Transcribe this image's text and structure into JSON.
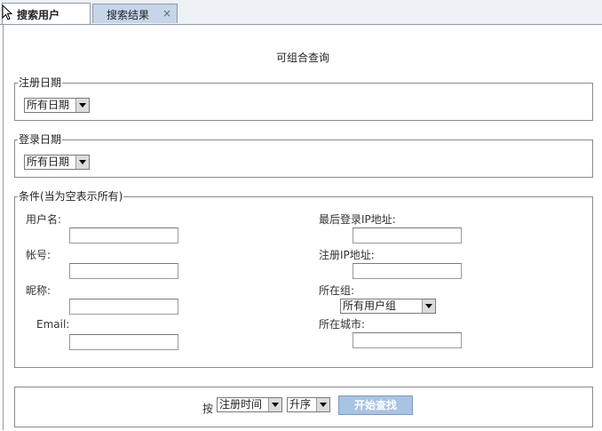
{
  "tabs": [
    {
      "label": "搜索用户",
      "active": true
    },
    {
      "label": "搜索结果",
      "active": false
    }
  ],
  "close_icon": "×",
  "page_title": "可组合查询",
  "register_date": {
    "legend": "注册日期",
    "selected": "所有日期"
  },
  "login_date": {
    "legend": "登录日期",
    "selected": "所有日期"
  },
  "conditions": {
    "legend": "条件(当为空表示所有)",
    "username_label": "用户名:",
    "account_label": "帐号:",
    "nickname_label": "昵称:",
    "email_label": "Email:",
    "last_login_ip_label": "最后登录IP地址:",
    "register_ip_label": "注册IP地址:",
    "group_label": "所在组:",
    "group_selected": "所有用户组",
    "city_label": "所在城市:"
  },
  "sort": {
    "by_label": "按",
    "field_selected": "注册时间",
    "order_selected": "升序",
    "search_button": "开始查找"
  },
  "colors": {
    "tab_active": "#ffffff",
    "tab_inactive": "#c6d6ea",
    "button_bg": "#a8c4e2"
  }
}
